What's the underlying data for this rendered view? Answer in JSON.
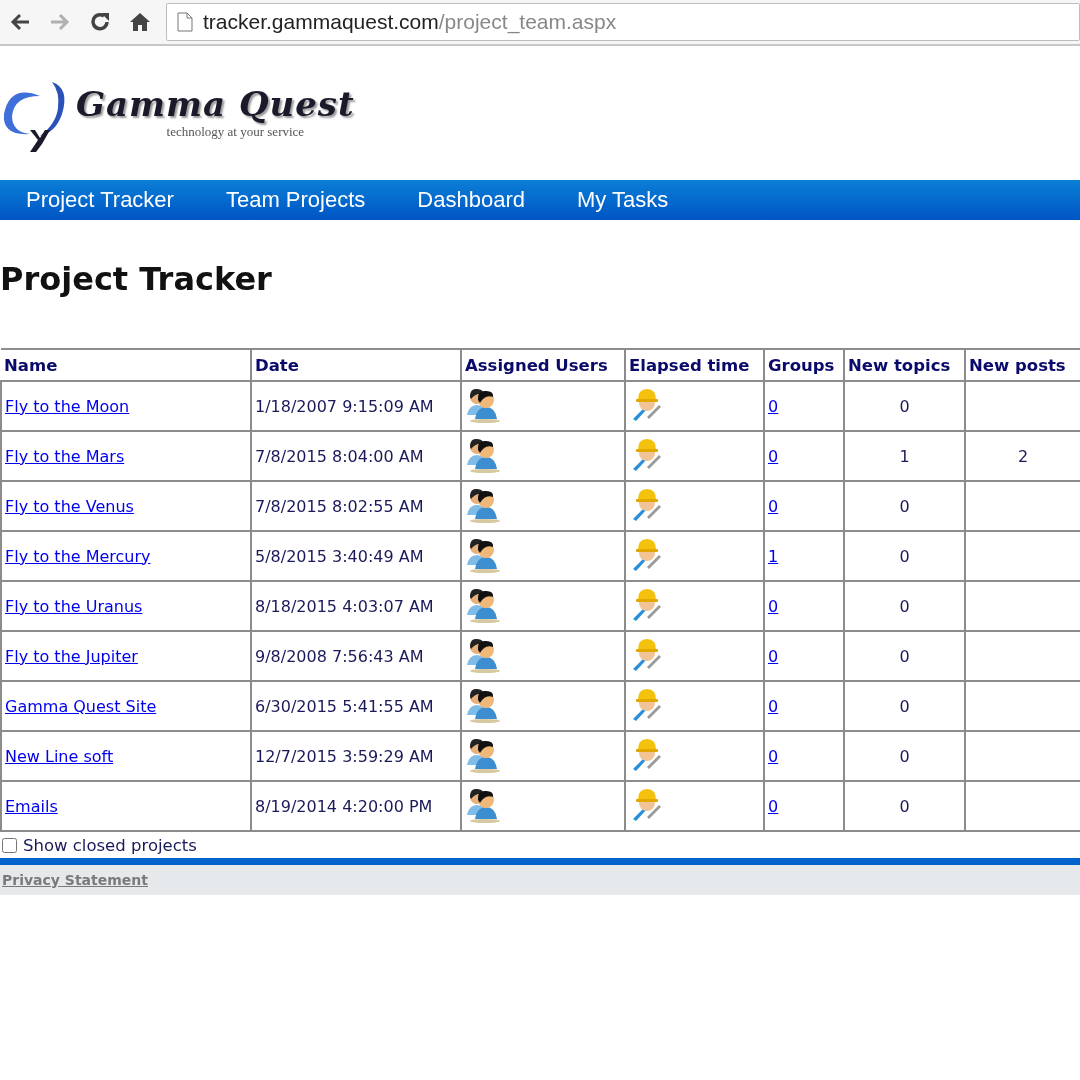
{
  "browser": {
    "back_disabled": false,
    "forward_disabled": true,
    "url_host": "tracker.gammaquest.com",
    "url_path": "/project_team.aspx"
  },
  "logo": {
    "name": "Gamma Quest",
    "tagline": "technology at your service"
  },
  "nav": [
    "Project Tracker",
    "Team Projects",
    "Dashboard",
    "My Tasks"
  ],
  "heading": "Project Tracker",
  "table": {
    "columns": [
      "Name",
      "Date",
      "Assigned Users",
      "Elapsed time",
      "Groups",
      "New topics",
      "New posts"
    ],
    "rows": [
      {
        "name": "Fly to the Moon",
        "date": "1/18/2007 9:15:09 AM",
        "groups": "0",
        "new_topics": "0"
      },
      {
        "name": "Fly to the Mars",
        "date": "7/8/2015 8:04:00 AM",
        "groups": "0",
        "new_topics": "1",
        "new_posts": "2"
      },
      {
        "name": "Fly to the Venus",
        "date": "7/8/2015 8:02:55 AM",
        "groups": "0",
        "new_topics": "0"
      },
      {
        "name": "Fly to the Mercury",
        "date": "5/8/2015 3:40:49 AM",
        "groups": "1",
        "new_topics": "0"
      },
      {
        "name": "Fly to the Uranus",
        "date": "8/18/2015 4:03:07 AM",
        "groups": "0",
        "new_topics": "0"
      },
      {
        "name": "Fly to the Jupiter",
        "date": "9/8/2008 7:56:43 AM",
        "groups": "0",
        "new_topics": "0"
      },
      {
        "name": "Gamma Quest Site",
        "date": "6/30/2015 5:41:55 AM",
        "groups": "0",
        "new_topics": "0"
      },
      {
        "name": "New Line soft",
        "date": "12/7/2015 3:59:29 AM",
        "groups": "0",
        "new_topics": "0"
      },
      {
        "name": "Emails",
        "date": "8/19/2014 4:20:00 PM",
        "groups": "0",
        "new_topics": "0"
      }
    ]
  },
  "show_closed": {
    "label": "Show closed projects",
    "checked": false
  },
  "footer": {
    "link": "Privacy Statement"
  }
}
